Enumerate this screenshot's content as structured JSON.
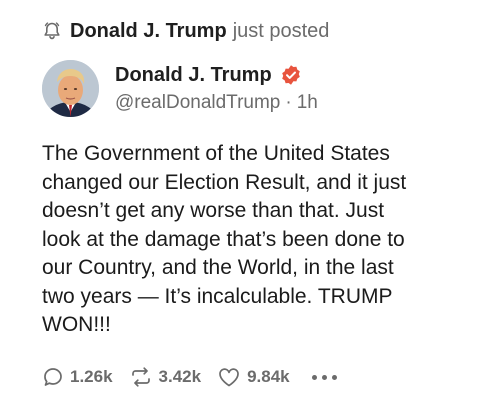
{
  "notification": {
    "name": "Donald J. Trump",
    "action": "just posted",
    "icon": "bell-icon"
  },
  "post": {
    "author_name": "Donald J. Trump",
    "verified": true,
    "handle": "@realDonaldTrump",
    "separator": "·",
    "time": "1h",
    "text": "The Government of the United States\nchanged our Election Result, and it just\ndoesn’t get any worse than that. Just\nlook at the damage that’s been done to\nour Country, and the World, in the last\ntwo years — It’s incalculable. TRUMP\nWON!!!"
  },
  "actions": {
    "replies": "1.26k",
    "reposts": "3.42k",
    "likes": "9.84k"
  },
  "colors": {
    "accent": "#e8543e",
    "muted": "#6b6b6b",
    "text": "#1b1b1b"
  }
}
